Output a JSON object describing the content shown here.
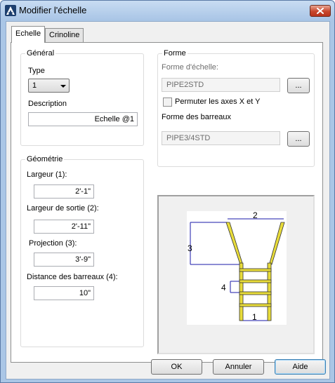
{
  "window": {
    "title": "Modifier l'échelle",
    "icon": "autocad-logo-icon"
  },
  "tabs": [
    {
      "label": "Echelle",
      "active": true
    },
    {
      "label": "Crinoline",
      "active": false
    }
  ],
  "general": {
    "title": "Général",
    "type_label": "Type",
    "type_value": "1",
    "description_label": "Description",
    "description_value": "Echelle @1"
  },
  "forme": {
    "title": "Forme",
    "forme_echelle_label": "Forme d'échelle:",
    "forme_echelle_value": "PIPE2STD",
    "browse_label": "...",
    "permuter_label": "Permuter les axes X et Y",
    "permuter_checked": false,
    "forme_barreaux_label": "Forme des barreaux",
    "forme_barreaux_value": "PIPE3/4STD"
  },
  "geometrie": {
    "title": "Géométrie",
    "largeur_label": "Largeur (1):",
    "largeur_value": "2'-1\"",
    "largeur_sortie_label": "Largeur de sortie (2):",
    "largeur_sortie_value": "2'-11\"",
    "projection_label": "Projection (3):",
    "projection_value": "3'-9\"",
    "distance_label": "Distance des barreaux (4):",
    "distance_value": "10\""
  },
  "preview": {
    "labels": [
      "1",
      "2",
      "3",
      "4"
    ]
  },
  "buttons": {
    "ok": "OK",
    "cancel": "Annuler",
    "help": "Aide"
  },
  "colors": {
    "ladder": "#e8dc3a",
    "dimension": "#1a1aa8"
  }
}
